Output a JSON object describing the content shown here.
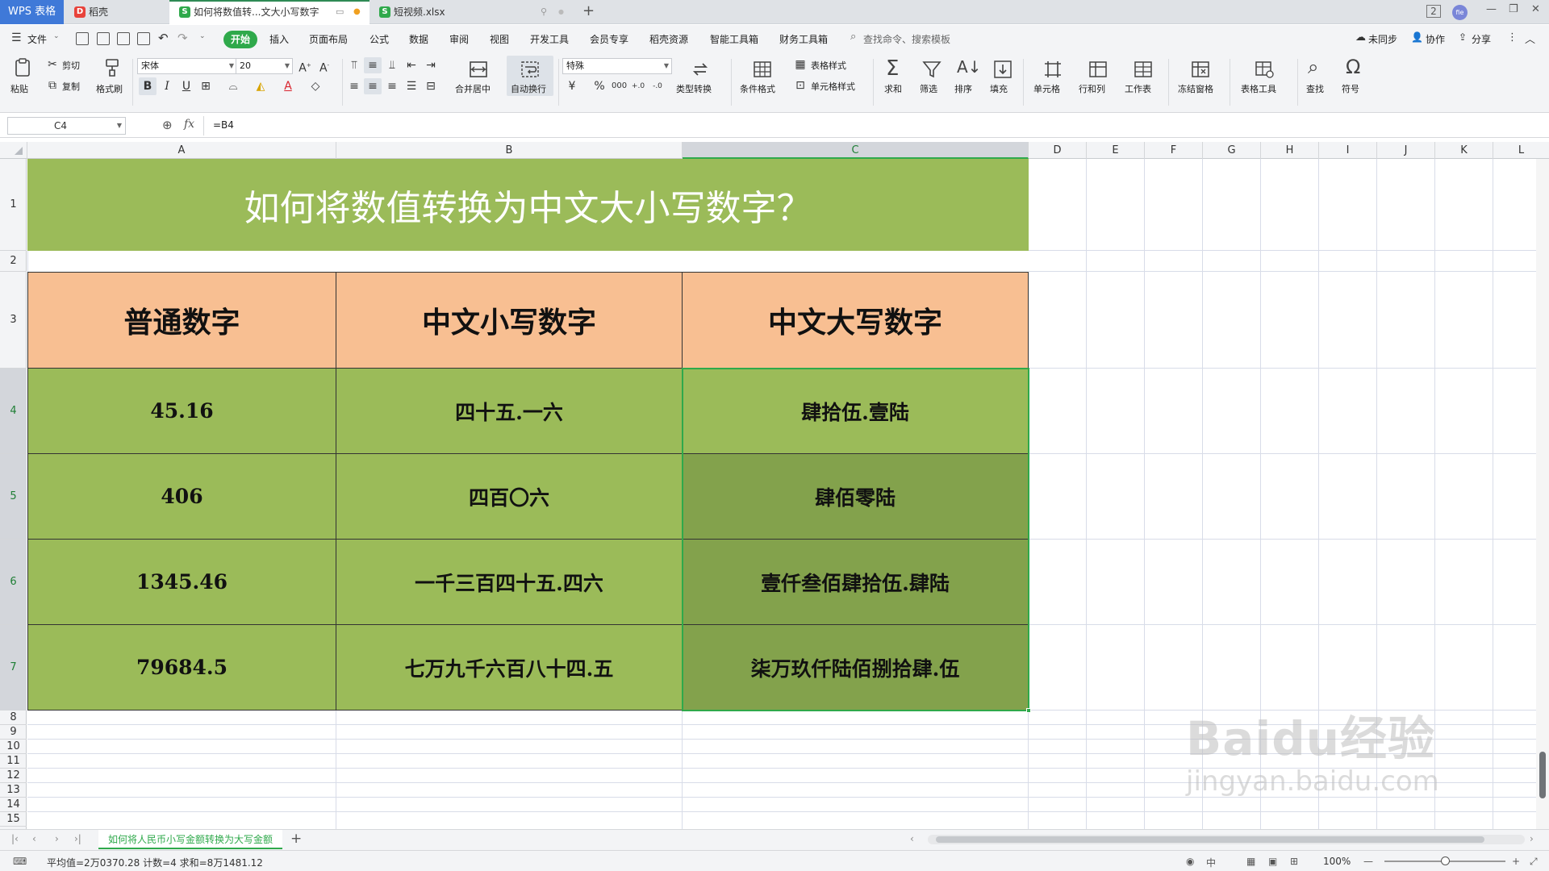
{
  "app": {
    "logo": "WPS 表格"
  },
  "tabs": [
    {
      "label": "稻壳"
    },
    {
      "label": "如何将数值转...文大小写数字"
    },
    {
      "label": "短视频.xlsx"
    }
  ],
  "menu": {
    "file": "文件",
    "items": [
      "开始",
      "插入",
      "页面布局",
      "公式",
      "数据",
      "审阅",
      "视图",
      "开发工具",
      "会员专享",
      "稻壳资源",
      "智能工具箱",
      "财务工具箱"
    ],
    "search": "查找命令、搜索模板",
    "sync": "未同步",
    "collab": "协作",
    "share": "分享"
  },
  "ribbon": {
    "paste": "粘贴",
    "cut": "剪切",
    "copy": "复制",
    "format_painter": "格式刷",
    "font_name": "宋体",
    "font_size": "20",
    "merge_center": "合并居中",
    "wrap_text": "自动换行",
    "number_format": "特殊",
    "type_convert": "类型转换",
    "conditional_format": "条件格式",
    "table_style": "表格样式",
    "cell_style": "单元格样式",
    "sum": "求和",
    "filter": "筛选",
    "sort": "排序",
    "fill": "填充",
    "cell": "单元格",
    "row_col": "行和列",
    "worksheet": "工作表",
    "freeze": "冻结窗格",
    "table_tools": "表格工具",
    "find": "查找",
    "symbol": "符号"
  },
  "formula_bar": {
    "name_box": "C4",
    "fx": "fx",
    "formula": "=B4"
  },
  "columns": [
    "A",
    "B",
    "C",
    "D",
    "E",
    "F",
    "G",
    "H",
    "I",
    "J",
    "K",
    "L"
  ],
  "rows": [
    "1",
    "2",
    "3",
    "4",
    "5",
    "6",
    "7",
    "8",
    "9",
    "10",
    "11",
    "12",
    "13",
    "14",
    "15"
  ],
  "sheet": {
    "title": "如何将数值转换为中文大小写数字？",
    "headers": [
      "普通数字",
      "中文小写数字",
      "中文大写数字"
    ],
    "data": [
      [
        "45.16",
        "四十五.一六",
        "肆拾伍.壹陆"
      ],
      [
        "406",
        "四百〇六",
        "肆佰零陆"
      ],
      [
        "1345.46",
        "一千三百四十五.四六",
        "壹仟叁佰肆拾伍.肆陆"
      ],
      [
        "79684.5",
        "七万九千六百八十四.五",
        "柒万玖仟陆佰捌拾肆.伍"
      ]
    ]
  },
  "sheet_tab": "如何将人民币小写金额转换为大写金额",
  "status": {
    "stats": "平均值=2万0370.28  计数=4  求和=8万1481.12",
    "zoom": "100%"
  },
  "watermark": {
    "brand": "Baidu经验",
    "url": "jingyan.baidu.com"
  },
  "colors": {
    "accent": "#2fa94b",
    "title_bg": "#9bbb59",
    "header_bg": "#f8bf92",
    "selected_bg": "#83a24c"
  }
}
